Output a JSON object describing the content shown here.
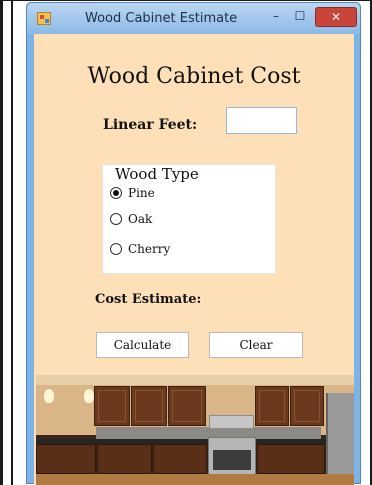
{
  "window": {
    "title": "Wood Cabinet Estimate",
    "minimize_label": "–",
    "maximize_label": "☐",
    "close_label": "✕"
  },
  "form": {
    "heading": "Wood Cabinet Cost",
    "linear_feet_label": "Linear Feet:",
    "linear_feet_value": "",
    "wood_type": {
      "legend": "Wood Type",
      "options": [
        "Pine",
        "Oak",
        "Cherry"
      ],
      "selected": "Pine"
    },
    "cost_estimate_label": "Cost Estimate:",
    "cost_estimate_value": "",
    "calculate_label": "Calculate",
    "clear_label": "Clear"
  },
  "colors": {
    "form_background": "#fde0b8",
    "window_frame": "#7fb2e6",
    "close_button": "#c9453a"
  },
  "icons": {
    "app_icon": "form-app-icon",
    "photo": "kitchen-cabinets-photo"
  }
}
